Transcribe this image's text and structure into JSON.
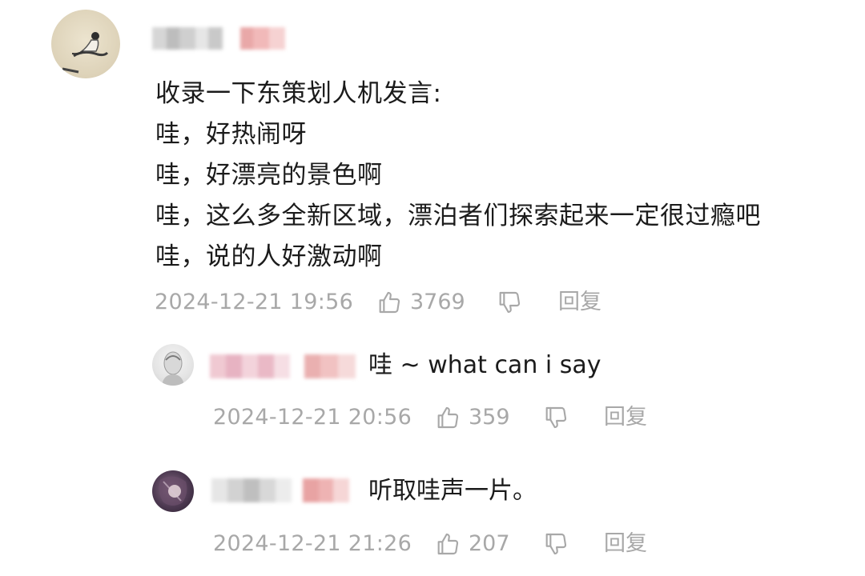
{
  "main_comment": {
    "lines": [
      "收录一下东策划人机发言:",
      "哇，好热闹呀",
      "哇，好漂亮的景色啊",
      "哇，这么多全新区域，漂泊者们探索起来一定很过瘾吧",
      "哇，说的人好激动啊"
    ],
    "timestamp": "2024-12-21 19:56",
    "like_count": "3769",
    "reply_label": "回复"
  },
  "replies": [
    {
      "text": "哇 ~ what can i say",
      "timestamp": "2024-12-21 20:56",
      "like_count": "359",
      "reply_label": "回复"
    },
    {
      "text": "听取哇声一片。",
      "timestamp": "2024-12-21 21:26",
      "like_count": "207",
      "reply_label": "回复"
    }
  ],
  "icons": {
    "like": "thumbs-up-icon",
    "dislike": "thumbs-down-icon"
  },
  "colors": {
    "meta_gray": "#a8a8a8",
    "text": "#1b1b1b",
    "blur_pink": "#e9a8a8",
    "blur_gray": "#d8d8d8"
  }
}
